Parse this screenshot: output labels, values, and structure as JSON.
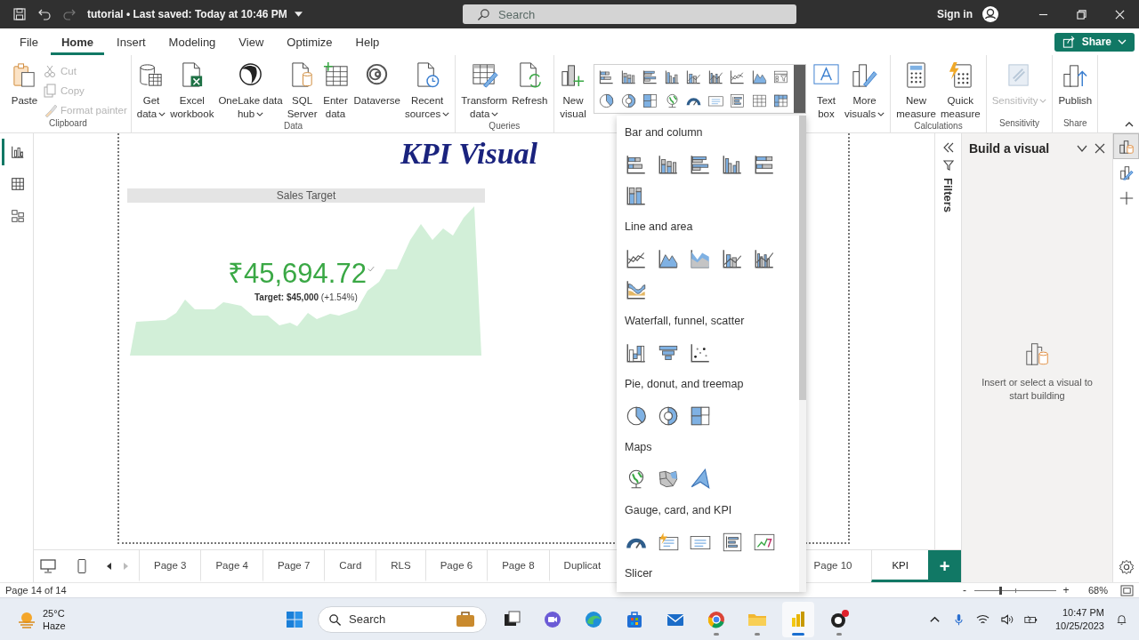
{
  "title_bar": {
    "document": "tutorial • Last saved: Today at 10:46 PM",
    "search": {
      "placeholder": "Search"
    },
    "sign_in": "Sign in"
  },
  "menu_tabs": [
    {
      "label": "File",
      "selected": false
    },
    {
      "label": "Home",
      "selected": true
    },
    {
      "label": "Insert",
      "selected": false
    },
    {
      "label": "Modeling",
      "selected": false
    },
    {
      "label": "View",
      "selected": false
    },
    {
      "label": "Optimize",
      "selected": false
    },
    {
      "label": "Help",
      "selected": false
    }
  ],
  "share_button": "Share",
  "ribbon": {
    "groups": [
      {
        "label": "Clipboard",
        "items": [
          {
            "kind": "paste",
            "lines": [
              "Paste"
            ],
            "dropdown": false,
            "disabled": false
          }
        ],
        "small_items": [
          {
            "kind": "cut",
            "label": "Cut",
            "disabled": true
          },
          {
            "kind": "copy",
            "label": "Copy",
            "disabled": true
          },
          {
            "kind": "painter",
            "label": "Format painter",
            "disabled": true
          }
        ]
      },
      {
        "label": "Data",
        "items": [
          {
            "kind": "database",
            "lines": [
              "Get",
              "data"
            ],
            "dropdown": true,
            "disabled": false
          },
          {
            "kind": "excel",
            "lines": [
              "Excel",
              "workbook"
            ],
            "dropdown": false,
            "disabled": false
          },
          {
            "kind": "onelake",
            "lines": [
              "OneLake data",
              "hub"
            ],
            "dropdown": true,
            "disabled": false
          },
          {
            "kind": "sql",
            "lines": [
              "SQL",
              "Server"
            ],
            "dropdown": false,
            "disabled": false
          },
          {
            "kind": "enter",
            "lines": [
              "Enter",
              "data"
            ],
            "dropdown": false,
            "disabled": false
          },
          {
            "kind": "dataverse",
            "lines": [
              "Dataverse"
            ],
            "dropdown": false,
            "disabled": false
          },
          {
            "kind": "recent",
            "lines": [
              "Recent",
              "sources"
            ],
            "dropdown": true,
            "disabled": false
          }
        ]
      },
      {
        "label": "Queries",
        "items": [
          {
            "kind": "transform",
            "lines": [
              "Transform",
              "data"
            ],
            "dropdown": true,
            "disabled": false
          },
          {
            "kind": "refresh",
            "lines": [
              "Refresh"
            ],
            "dropdown": false,
            "disabled": false
          }
        ]
      },
      {
        "items": [
          {
            "kind": "newvisual",
            "lines": [
              "New",
              "visual"
            ],
            "dropdown": false,
            "disabled": false
          },
          {
            "kind": "gallery",
            "rows": [
              [
                {
                  "kind": "hbar-stacked"
                },
                {
                  "kind": "col-stacked"
                },
                {
                  "kind": "hbar-clustered"
                },
                {
                  "kind": "col-clustered"
                },
                {
                  "kind": "line-col"
                },
                {
                  "kind": "line-col2"
                },
                {
                  "kind": "line"
                },
                {
                  "kind": "area"
                },
                {
                  "kind": "slicer"
                }
              ],
              [
                {
                  "kind": "pie"
                },
                {
                  "kind": "donut"
                },
                {
                  "kind": "treemap"
                },
                {
                  "kind": "globe"
                },
                {
                  "kind": "gauge"
                },
                {
                  "kind": "card"
                },
                {
                  "kind": "multirow"
                },
                {
                  "kind": "table"
                },
                {
                  "kind": "matrix"
                }
              ]
            ]
          },
          {
            "kind": "textbox",
            "lines": [
              "Text",
              "box"
            ],
            "dropdown": false,
            "disabled": false
          },
          {
            "kind": "morevisuals",
            "lines": [
              "More",
              "visuals"
            ],
            "dropdown": true,
            "disabled": false
          }
        ]
      },
      {
        "label": "Calculations",
        "items": [
          {
            "kind": "calculator",
            "lines": [
              "New",
              "measure"
            ],
            "dropdown": false,
            "disabled": false
          },
          {
            "kind": "quickmeasure",
            "lines": [
              "Quick",
              "measure"
            ],
            "dropdown": false,
            "disabled": false
          }
        ]
      },
      {
        "label": "Sensitivity",
        "items": [
          {
            "kind": "sensitivity",
            "lines": [
              "Sensitivity"
            ],
            "dropdown": true,
            "disabled": true
          }
        ]
      },
      {
        "label": "Share",
        "items": [
          {
            "kind": "publish",
            "lines": [
              "Publish"
            ],
            "dropdown": false,
            "disabled": false
          }
        ]
      }
    ]
  },
  "left_rail": [
    {
      "kind": "report",
      "selected": true
    },
    {
      "kind": "table",
      "selected": false
    },
    {
      "kind": "model",
      "selected": false
    }
  ],
  "canvas": {
    "title": "KPI Visual",
    "kpi": {
      "header": "Sales Target",
      "value": "₹45,694.72",
      "target": "**Target: $45,000** (+1.54%)"
    }
  },
  "visual_menu": [
    {
      "heading": "Bar and column",
      "visuals": [
        {
          "kind": "hbar-stacked"
        },
        {
          "kind": "col-stacked"
        },
        {
          "kind": "hbar-clustered"
        },
        {
          "kind": "col-clustered"
        },
        {
          "kind": "hbar-100"
        },
        {
          "kind": "col-100"
        }
      ]
    },
    {
      "heading": "Line and area",
      "visuals": [
        {
          "kind": "line"
        },
        {
          "kind": "area"
        },
        {
          "kind": "stacked-area"
        },
        {
          "kind": "line-col"
        },
        {
          "kind": "line-col2"
        },
        {
          "kind": "ribbon"
        }
      ]
    },
    {
      "heading": "Waterfall, funnel, scatter",
      "visuals": [
        {
          "kind": "waterfall"
        },
        {
          "kind": "funnel"
        },
        {
          "kind": "scatter"
        }
      ]
    },
    {
      "heading": "Pie, donut, and treemap",
      "visuals": [
        {
          "kind": "pie"
        },
        {
          "kind": "donut"
        },
        {
          "kind": "treemap"
        }
      ]
    },
    {
      "heading": "Maps",
      "visuals": [
        {
          "kind": "globe"
        },
        {
          "kind": "filled-map"
        },
        {
          "kind": "arrow"
        }
      ]
    },
    {
      "heading": "Gauge, card, and KPI",
      "visuals": [
        {
          "kind": "gauge"
        },
        {
          "kind": "card-spark"
        },
        {
          "kind": "card"
        },
        {
          "kind": "multirow"
        },
        {
          "kind": "kpi"
        }
      ]
    },
    {
      "heading": "Slicer"
    }
  ],
  "page_tabs": {
    "pages_left": [
      {
        "label": "Page 3",
        "selected": false
      },
      {
        "label": "Page 4",
        "selected": false
      },
      {
        "label": "Page 7",
        "selected": false
      },
      {
        "label": "Card",
        "selected": false
      },
      {
        "label": "RLS",
        "selected": false
      },
      {
        "label": "Page 6",
        "selected": false
      },
      {
        "label": "Page 8",
        "selected": false
      },
      {
        "label": "Duplicat",
        "selected": false
      }
    ],
    "pages_right": [
      {
        "label": "Page 10",
        "selected": false
      },
      {
        "label": "KPI",
        "selected": true
      }
    ],
    "add_page": "+"
  },
  "filters_pane": {
    "label": "Filters"
  },
  "build_pane": {
    "title": "Build a visual",
    "hint": "Insert or select a visual to start building"
  },
  "right_rail": [
    {
      "kind": "build",
      "selected": true
    },
    {
      "kind": "format",
      "selected": false
    },
    {
      "kind": "add",
      "selected": false
    }
  ],
  "status_bar": {
    "page": "Page 14 of 14",
    "zoom": {
      "minus": "-",
      "plus": "+",
      "level": 0.32,
      "reading": "68%"
    }
  },
  "taskbar": {
    "weather": {
      "temp": "25°C",
      "condition": "Haze"
    },
    "search": {
      "placeholder": "Search"
    },
    "apps": [
      {
        "kind": "taskview",
        "running": false,
        "selected": false
      },
      {
        "kind": "meet",
        "running": false,
        "selected": false
      },
      {
        "kind": "edge",
        "running": false,
        "selected": false
      },
      {
        "kind": "store",
        "running": false,
        "selected": false
      },
      {
        "kind": "mail",
        "running": false,
        "selected": false
      },
      {
        "kind": "chrome",
        "running": true,
        "selected": false
      },
      {
        "kind": "folder",
        "running": true,
        "selected": false
      },
      {
        "kind": "powerbi",
        "running": true,
        "selected": true
      },
      {
        "kind": "obs",
        "running": true,
        "selected": false
      }
    ],
    "time": "10:47 PM",
    "date": "10/25/2023"
  }
}
